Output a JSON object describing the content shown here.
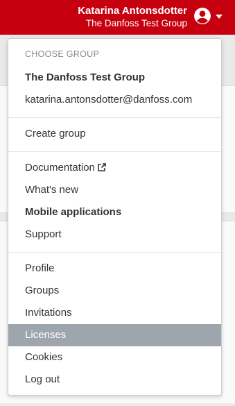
{
  "header": {
    "user_name": "Katarina Antonsdotter",
    "group_name": "The Danfoss Test Group",
    "avatar_icon": "account-circle-icon",
    "dropdown_icon": "caret-down-icon",
    "brand_color": "#c7000f"
  },
  "menu": {
    "section_label": "CHOOSE GROUP",
    "current_group": "The Danfoss Test Group",
    "email": "katarina.antonsdotter@danfoss.com",
    "create_group": "Create group",
    "documentation": "Documentation",
    "documentation_icon": "external-link-icon",
    "whats_new": "What's new",
    "mobile_applications": "Mobile applications",
    "support": "Support",
    "profile": "Profile",
    "groups": "Groups",
    "invitations": "Invitations",
    "licenses": "Licenses",
    "cookies": "Cookies",
    "log_out": "Log out",
    "selected_item": "Licenses",
    "selected_color": "#9ea5ad"
  }
}
